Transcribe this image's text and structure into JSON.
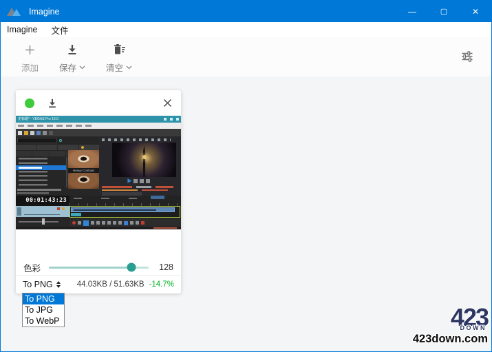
{
  "window": {
    "title": "Imagine",
    "controls": {
      "minimize": "—",
      "maximize": "▢",
      "close": "✕"
    }
  },
  "menubar": {
    "items": [
      {
        "label": "Imagine"
      },
      {
        "label": "文件"
      }
    ]
  },
  "toolbar": {
    "add_label": "添加",
    "save_label": "保存",
    "clear_label": "清空"
  },
  "card": {
    "thumbnail": {
      "app_title": "无标题* - VEGAS Pro 16.0",
      "preset_label": "Heavy Contrast",
      "timecode": "00:01:43:23"
    },
    "slider": {
      "label": "色彩",
      "value": "128",
      "percent": 83
    },
    "format_select": {
      "value": "To PNG"
    },
    "size_text": "44.03KB / 51.63KB",
    "savings_text": "-14.7%"
  },
  "dropdown": {
    "options": [
      {
        "label": "To PNG",
        "selected": true
      },
      {
        "label": "To JPG",
        "selected": false
      },
      {
        "label": "To WebP",
        "selected": false
      }
    ]
  },
  "watermark": {
    "big": "423",
    "sub": "DOWN",
    "domain": "423down.com"
  },
  "colors": {
    "titlebar": "#0078d7",
    "selection": "#0078d7",
    "status_dot": "#3ecb3e",
    "slider_thumb": "#2a9d92",
    "slider_track": "#c2e2de",
    "savings_green": "#00b321",
    "content_bg": "#f4f5f6"
  }
}
